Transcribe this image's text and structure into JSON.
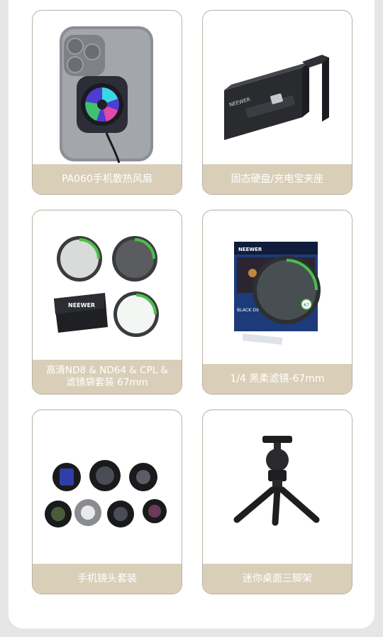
{
  "products": [
    {
      "label": "PA060手机散热风扇",
      "icon": "phone-cooling-fan"
    },
    {
      "label": "固态硬盘/充电宝夹座",
      "icon": "ssd-clamp-mount"
    },
    {
      "label": "高清ND8 & ND64 & CPL &\n滤镜袋套装 67mm",
      "icon": "filter-kit",
      "brand": "NEEWER"
    },
    {
      "label": "1/4 黑柔滤镜-67mm",
      "icon": "black-diffusion-filter",
      "brand": "NEEWER",
      "box_text": "BLACK DIFFUSION FILTER 1/4",
      "size": "67"
    },
    {
      "label": "手机镜头套装",
      "icon": "phone-lens-kit"
    },
    {
      "label": "迷你桌面三脚架",
      "icon": "mini-tripod"
    }
  ],
  "colors": {
    "label_bg": "#d9cfb8",
    "card_border": "#b8b2a2",
    "page_bg": "#e6e6e6"
  }
}
